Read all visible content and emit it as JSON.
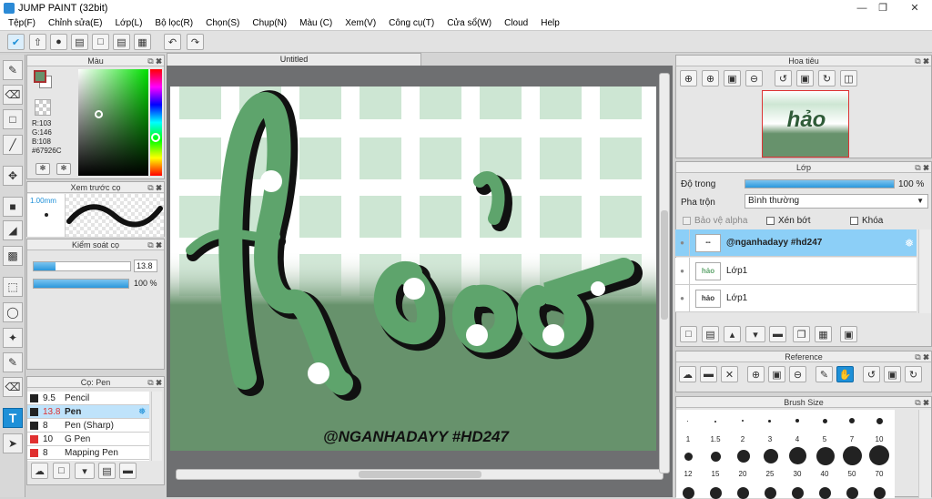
{
  "app": {
    "title": "JUMP PAINT (32bit)"
  },
  "menu": [
    "Tệp(F)",
    "Chỉnh sửa(E)",
    "Lớp(L)",
    "Bộ lọc(R)",
    "Chọn(S)",
    "Chụp(N)",
    "Màu (C)",
    "Xem(V)",
    "Công cụ(T)",
    "Cửa sổ(W)",
    "Cloud",
    "Help"
  ],
  "color_panel": {
    "title": "Màu",
    "r": "R:103",
    "g": "G:146",
    "b": "B:108",
    "hex": "#67926C",
    "fg": "#67926C"
  },
  "brush_preview": {
    "title": "Xem trước cọ",
    "size": "1.00mm"
  },
  "brush_control": {
    "title": "Kiểm soát cọ",
    "size_value": "13.8",
    "opacity_value": "100 %",
    "size_fill": 0.23,
    "opacity_fill": 1.0
  },
  "brush_list": {
    "title": "Cọ: Pen",
    "items": [
      {
        "size": "9.5",
        "name": "Pencil",
        "color": "#222222"
      },
      {
        "size": "13.8",
        "name": "Pen",
        "color": "#222222",
        "selected": true
      },
      {
        "size": "8",
        "name": "Pen (Sharp)",
        "color": "#222222"
      },
      {
        "size": "10",
        "name": "G Pen",
        "color": "#e03030"
      },
      {
        "size": "8",
        "name": "Mapping Pen",
        "color": "#e03030"
      }
    ]
  },
  "canvas": {
    "tab": "Untitled",
    "art_letters": "hảo",
    "art_caption": "@NGANHADAYY #HD247"
  },
  "navigator": {
    "title": "Hoa tiêu"
  },
  "layers": {
    "title": "Lớp",
    "opacity_label": "Độ trong",
    "opacity_value": "100 %",
    "opacity_fill": 1.0,
    "blend_label": "Pha trộn",
    "blend_value": "Bình thường",
    "protect_alpha": "Bảo vệ alpha",
    "clipping": "Xén bớt",
    "lock": "Khóa",
    "items": [
      {
        "name": "@nganhadayy #hd247",
        "selected": true
      },
      {
        "name": "Lớp1"
      },
      {
        "name": "Lớp1"
      }
    ]
  },
  "reference": {
    "title": "Reference"
  },
  "brush_size": {
    "title": "Brush Size",
    "row1": [
      "1",
      "1.5",
      "2",
      "3",
      "4",
      "5",
      "7",
      "10"
    ],
    "row2": [
      "12",
      "15",
      "20",
      "25",
      "30",
      "40",
      "50",
      "70"
    ]
  },
  "colors": {
    "accent": "#1e90d8",
    "green_light": "#8fcf98",
    "green_dark": "#4f8a5a",
    "bg_green": "#67926c"
  }
}
